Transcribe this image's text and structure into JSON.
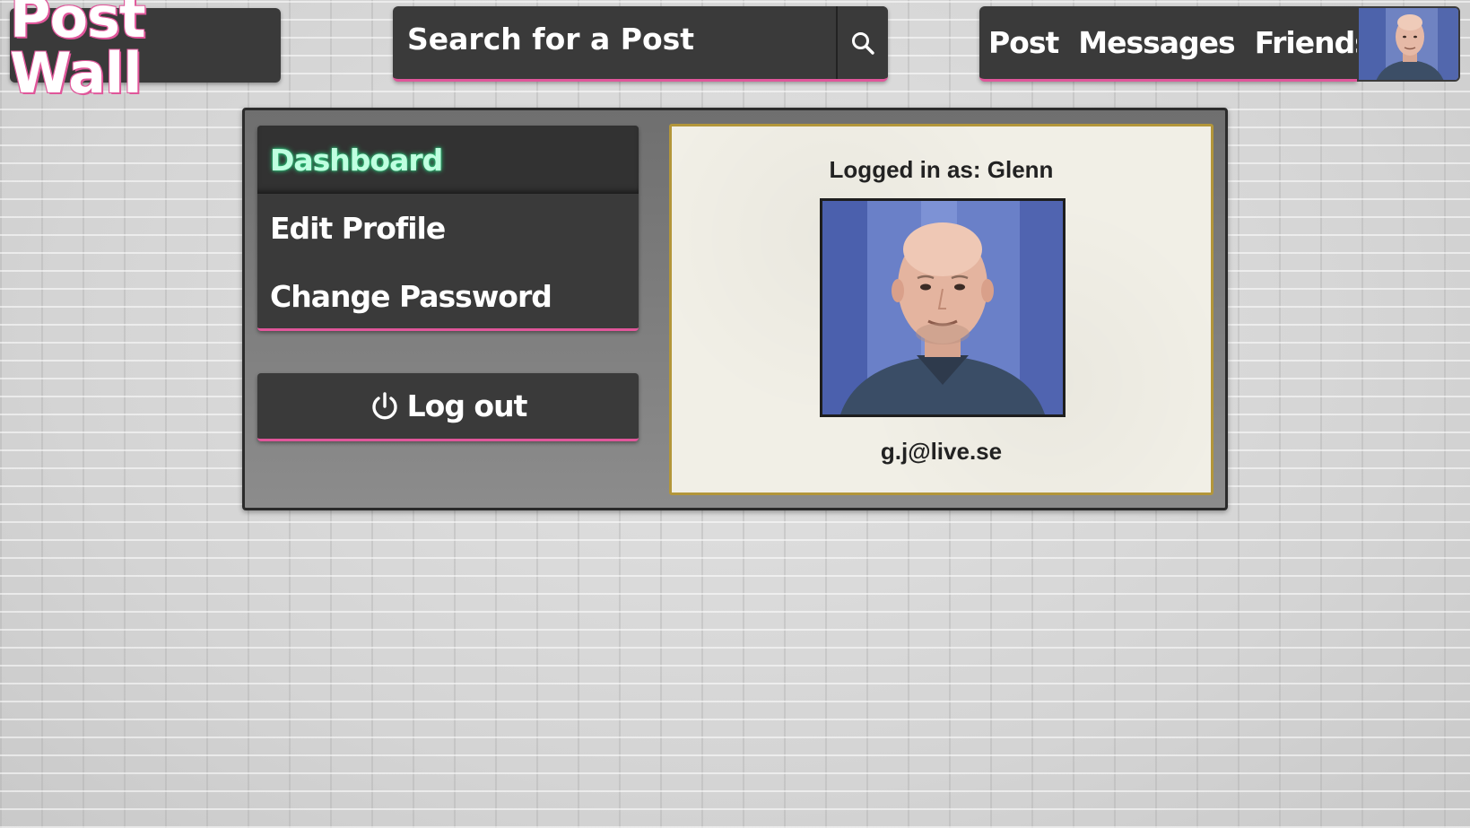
{
  "header": {
    "logo_text": "Post Wall",
    "search": {
      "placeholder": "Search for a Post",
      "icon": "search-icon"
    },
    "nav": {
      "post_label": "Post",
      "messages_label": "Messages",
      "friends_label": "Friends"
    },
    "avatar_icon": "user-avatar"
  },
  "sidebar": {
    "items": [
      {
        "label": "Dashboard",
        "active": true
      },
      {
        "label": "Edit Profile",
        "active": false
      },
      {
        "label": "Change Password",
        "active": false
      }
    ],
    "logout_label": "Log out",
    "logout_icon": "power-icon"
  },
  "profile": {
    "logged_in_text": "Logged in as: Glenn",
    "email": "g.j@live.se"
  },
  "colors": {
    "panel_dark": "#3a3a3a",
    "accent_pink": "#e0569a",
    "active_glow": "#2ad17f",
    "card_border": "#b3963a",
    "card_bg": "#f1efe6"
  }
}
